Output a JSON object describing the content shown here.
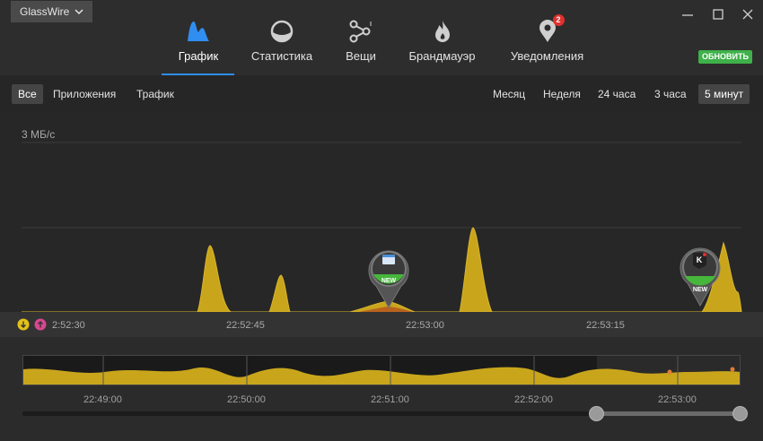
{
  "app": {
    "menu_label": "GlassWire"
  },
  "nav": {
    "graph": "График",
    "stats": "Статистика",
    "things": "Вещи",
    "firewall": "Брандмауэр",
    "alerts": "Уведомления",
    "alerts_count": "2"
  },
  "update_label": "ОБНОВИТЬ",
  "filters": {
    "all": "Все",
    "apps": "Приложения",
    "traffic": "Трафик"
  },
  "ranges": {
    "month": "Месяц",
    "week": "Неделя",
    "h24": "24 часа",
    "h3": "3 часа",
    "m5": "5 минут"
  },
  "graph": {
    "ylabel": "3 МБ/с",
    "ticks": [
      "2:52:30",
      "22:52:45",
      "22:53:00",
      "22:53:15"
    ],
    "pin_new": "NEW",
    "colors": {
      "traffic": "#c9a51c",
      "background": "#272727"
    }
  },
  "timeline": {
    "ticks": [
      "22:49:00",
      "22:50:00",
      "22:51:00",
      "22:52:00",
      "22:53:00"
    ]
  }
}
